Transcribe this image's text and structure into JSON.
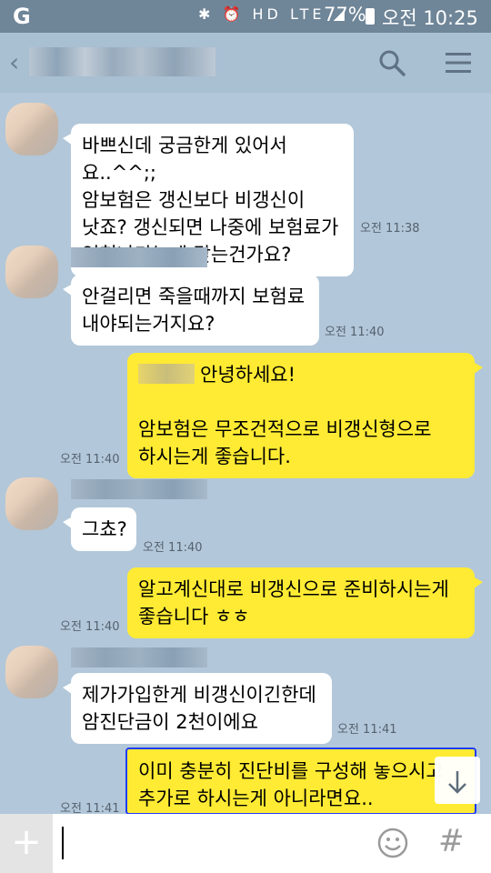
{
  "status": {
    "carrier_logo": "G",
    "network": "LTE",
    "battery": "77%",
    "time": "오전 10:25"
  },
  "header": {
    "back_icon": "chevron-left-icon",
    "search_icon": "search-icon",
    "menu_icon": "hamburger-menu-icon"
  },
  "messages": [
    {
      "text": "바쁘신데 궁금한게 있어서요..^^;;\n암보험은 갱신보다 비갱신이\n낫죠? 갱신되면 나중에 보험료가\n엄청나다는게 맞는건가요?",
      "time": "오전 11:38"
    },
    {
      "text": "안걸리면 죽을때까지 보험료\n내야되는거지요?",
      "time": "오전 11:40"
    },
    {
      "text_first": "안녕하세요!",
      "text_rest": "\n\n암보험은 무조건적으로 비갱신형으로\n하시는게 좋습니다.",
      "time": "오전 11:40"
    },
    {
      "text": "그쵸?",
      "time": "오전 11:40"
    },
    {
      "text": "알고계신대로 비갱신으로 준비하시는게\n좋습니다 ㅎㅎ",
      "time": "오전 11:40"
    },
    {
      "text": "제가가입한게 비갱신이긴한데\n암진단금이 2천이에요",
      "time": "오전 11:41"
    },
    {
      "text": "이미 충분히 진단비를 구성해 놓으시고\n추가로 하시는게 아니라면요..",
      "time": "오전 11:41"
    }
  ],
  "input": {
    "plus_label": "+",
    "emoji_icon": "smiley-icon",
    "hash_label": "#"
  },
  "colors": {
    "background": "#b2c7d9",
    "outgoing_bubble": "#ffeb33",
    "incoming_bubble": "#ffffff"
  }
}
